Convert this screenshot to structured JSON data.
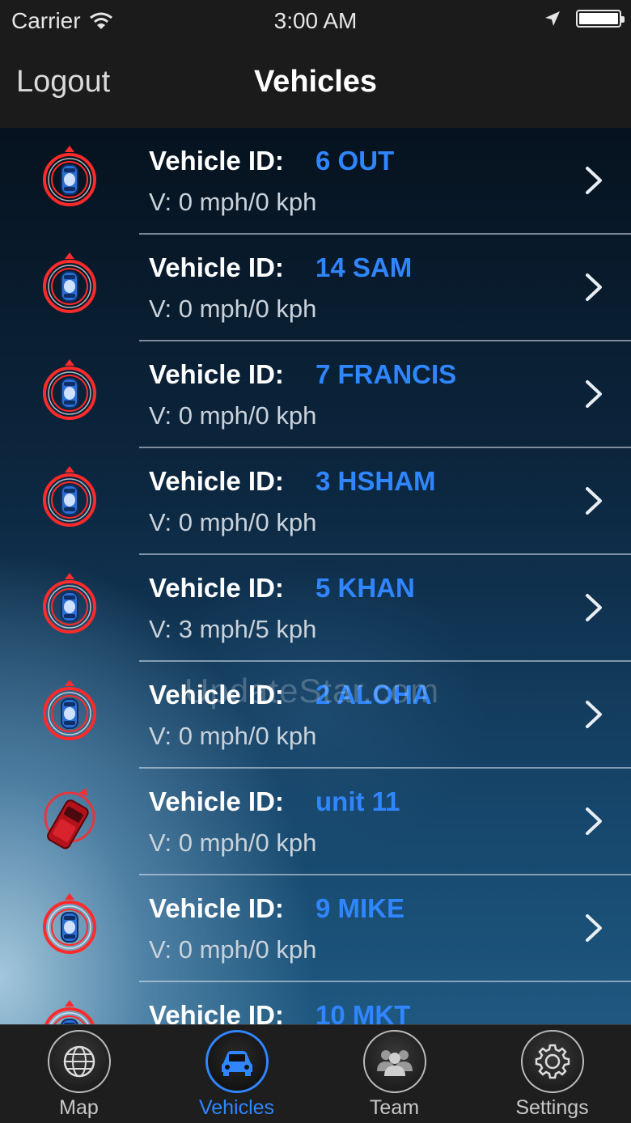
{
  "status_bar": {
    "carrier": "Carrier",
    "time": "3:00 AM"
  },
  "nav": {
    "left_button": "Logout",
    "title": "Vehicles"
  },
  "watermark": "UpdateStar.com",
  "vehicles": [
    {
      "label": "Vehicle ID:",
      "id": "6 OUT",
      "speed": "V:  0 mph/0 kph",
      "icon": "vehicle-blue-icon"
    },
    {
      "label": "Vehicle ID:",
      "id": "14 SAM",
      "speed": "V:  0 mph/0 kph",
      "icon": "vehicle-blue-icon"
    },
    {
      "label": "Vehicle ID:",
      "id": "7 FRANCIS",
      "speed": "V:  0 mph/0 kph",
      "icon": "vehicle-blue-icon"
    },
    {
      "label": "Vehicle ID:",
      "id": "3 HSHAM",
      "speed": "V:  0 mph/0 kph",
      "icon": "vehicle-blue-icon"
    },
    {
      "label": "Vehicle ID:",
      "id": "5 KHAN",
      "speed": "V:  3 mph/5 kph",
      "icon": "vehicle-blue-icon"
    },
    {
      "label": "Vehicle ID:",
      "id": "2 ALOHA",
      "speed": "V:  0 mph/0 kph",
      "icon": "vehicle-blue-icon"
    },
    {
      "label": "Vehicle ID:",
      "id": "unit 11",
      "speed": "V:  0 mph/0 kph",
      "icon": "vehicle-red-truck-icon"
    },
    {
      "label": "Vehicle ID:",
      "id": "9 MIKE",
      "speed": "V:  0 mph/0 kph",
      "icon": "vehicle-blue-icon"
    },
    {
      "label": "Vehicle ID:",
      "id": "10 MKT",
      "speed": "",
      "icon": "vehicle-blue-icon"
    }
  ],
  "tabs": [
    {
      "label": "Map",
      "icon": "globe-icon",
      "active": false
    },
    {
      "label": "Vehicles",
      "icon": "car-icon",
      "active": true
    },
    {
      "label": "Team",
      "icon": "team-icon",
      "active": false
    },
    {
      "label": "Settings",
      "icon": "gear-icon",
      "active": false
    }
  ],
  "colors": {
    "accent": "#2f86ff",
    "marker": "#ff2a2a",
    "bar": "#1b1b1b"
  }
}
